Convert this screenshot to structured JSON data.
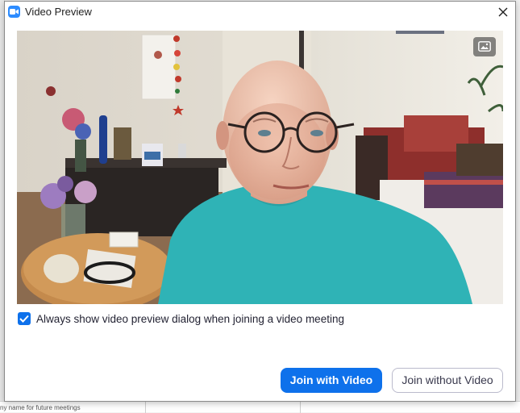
{
  "window": {
    "title": "Video Preview",
    "close_icon": "close-icon",
    "app_icon": "zoom-camera-icon"
  },
  "video": {
    "pip_icon": "picture-in-picture-icon"
  },
  "preference": {
    "label": "Always show video preview dialog when joining a video meeting",
    "checked": true
  },
  "actions": {
    "join_with_video": "Join with Video",
    "join_without_video": "Join without Video"
  },
  "background": {
    "bottom_text": "ny name for future meetings"
  },
  "colors": {
    "accent": "#0e71eb",
    "app_icon": "#2d8cff"
  }
}
